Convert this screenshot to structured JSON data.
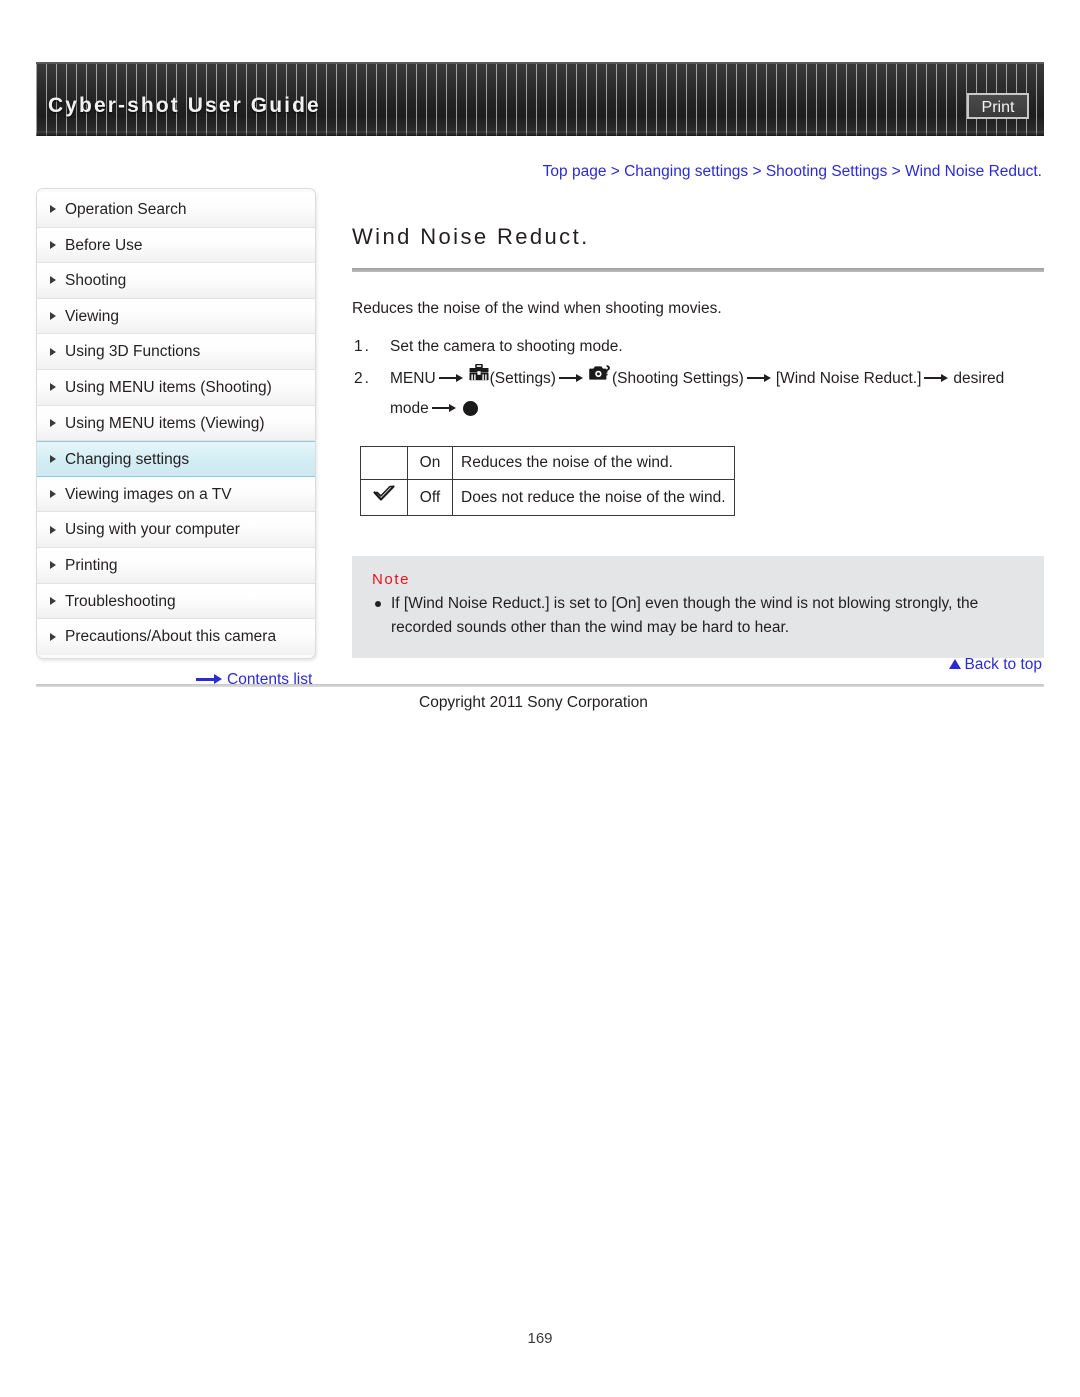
{
  "header": {
    "title": "Cyber-shot User Guide",
    "print_label": "Print"
  },
  "breadcrumb": {
    "text": "Top page > Changing settings > Shooting Settings > Wind Noise Reduct."
  },
  "sidebar": {
    "items": [
      {
        "label": "Operation Search",
        "active": false
      },
      {
        "label": "Before Use",
        "active": false
      },
      {
        "label": "Shooting",
        "active": false
      },
      {
        "label": "Viewing",
        "active": false
      },
      {
        "label": "Using 3D Functions",
        "active": false
      },
      {
        "label": "Using MENU items (Shooting)",
        "active": false
      },
      {
        "label": "Using MENU items (Viewing)",
        "active": false
      },
      {
        "label": "Changing settings",
        "active": true
      },
      {
        "label": "Viewing images on a TV",
        "active": false
      },
      {
        "label": "Using with your computer",
        "active": false
      },
      {
        "label": "Printing",
        "active": false
      },
      {
        "label": "Troubleshooting",
        "active": false
      },
      {
        "label": "Precautions/About this camera",
        "active": false
      }
    ],
    "contents_list_label": "Contents list"
  },
  "main": {
    "title": "Wind Noise Reduct.",
    "intro": "Reduces the noise of the wind when shooting movies.",
    "step1": {
      "number": "1.",
      "text": "Set the camera to shooting mode."
    },
    "step2": {
      "number": "2.",
      "menu": "MENU",
      "settings_label": "(Settings)",
      "shooting_settings_label": "(Shooting Settings)",
      "item_label": "[Wind Noise Reduct.]",
      "desired": "desired",
      "mode": "mode"
    },
    "options_table": {
      "rows": [
        {
          "checked": "",
          "option": "On",
          "description": "Reduces the noise of the wind."
        },
        {
          "checked": "check",
          "option": "Off",
          "description": "Does not reduce the noise of the wind."
        }
      ]
    },
    "note": {
      "title": "Note",
      "items": [
        "If [Wind Noise Reduct.] is set to [On] even though the wind is not blowing strongly, the recorded sounds other than the wind may be hard to hear."
      ]
    }
  },
  "footer": {
    "back_to_top_label": "Back to top",
    "copyright": "Copyright 2011 Sony Corporation",
    "page_number": "169"
  },
  "colors": {
    "link": "#2b2bd4",
    "note_title": "#e8121a",
    "active_nav": "#d3edf4",
    "banner": "#2e2e2e"
  }
}
